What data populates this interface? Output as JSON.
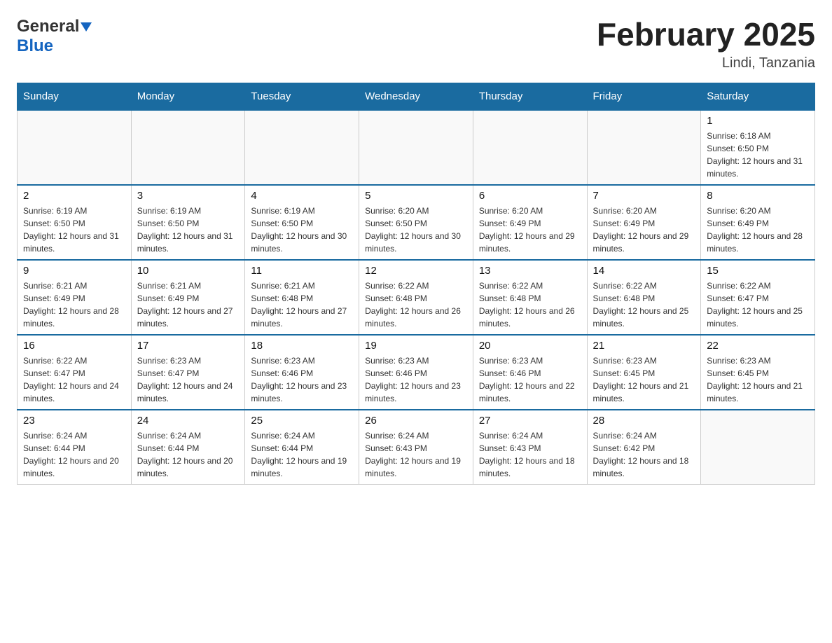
{
  "header": {
    "logo_general": "General",
    "logo_blue": "Blue",
    "month_title": "February 2025",
    "location": "Lindi, Tanzania"
  },
  "weekdays": [
    "Sunday",
    "Monday",
    "Tuesday",
    "Wednesday",
    "Thursday",
    "Friday",
    "Saturday"
  ],
  "weeks": [
    [
      {
        "day": "",
        "info": ""
      },
      {
        "day": "",
        "info": ""
      },
      {
        "day": "",
        "info": ""
      },
      {
        "day": "",
        "info": ""
      },
      {
        "day": "",
        "info": ""
      },
      {
        "day": "",
        "info": ""
      },
      {
        "day": "1",
        "info": "Sunrise: 6:18 AM\nSunset: 6:50 PM\nDaylight: 12 hours and 31 minutes."
      }
    ],
    [
      {
        "day": "2",
        "info": "Sunrise: 6:19 AM\nSunset: 6:50 PM\nDaylight: 12 hours and 31 minutes."
      },
      {
        "day": "3",
        "info": "Sunrise: 6:19 AM\nSunset: 6:50 PM\nDaylight: 12 hours and 31 minutes."
      },
      {
        "day": "4",
        "info": "Sunrise: 6:19 AM\nSunset: 6:50 PM\nDaylight: 12 hours and 30 minutes."
      },
      {
        "day": "5",
        "info": "Sunrise: 6:20 AM\nSunset: 6:50 PM\nDaylight: 12 hours and 30 minutes."
      },
      {
        "day": "6",
        "info": "Sunrise: 6:20 AM\nSunset: 6:49 PM\nDaylight: 12 hours and 29 minutes."
      },
      {
        "day": "7",
        "info": "Sunrise: 6:20 AM\nSunset: 6:49 PM\nDaylight: 12 hours and 29 minutes."
      },
      {
        "day": "8",
        "info": "Sunrise: 6:20 AM\nSunset: 6:49 PM\nDaylight: 12 hours and 28 minutes."
      }
    ],
    [
      {
        "day": "9",
        "info": "Sunrise: 6:21 AM\nSunset: 6:49 PM\nDaylight: 12 hours and 28 minutes."
      },
      {
        "day": "10",
        "info": "Sunrise: 6:21 AM\nSunset: 6:49 PM\nDaylight: 12 hours and 27 minutes."
      },
      {
        "day": "11",
        "info": "Sunrise: 6:21 AM\nSunset: 6:48 PM\nDaylight: 12 hours and 27 minutes."
      },
      {
        "day": "12",
        "info": "Sunrise: 6:22 AM\nSunset: 6:48 PM\nDaylight: 12 hours and 26 minutes."
      },
      {
        "day": "13",
        "info": "Sunrise: 6:22 AM\nSunset: 6:48 PM\nDaylight: 12 hours and 26 minutes."
      },
      {
        "day": "14",
        "info": "Sunrise: 6:22 AM\nSunset: 6:48 PM\nDaylight: 12 hours and 25 minutes."
      },
      {
        "day": "15",
        "info": "Sunrise: 6:22 AM\nSunset: 6:47 PM\nDaylight: 12 hours and 25 minutes."
      }
    ],
    [
      {
        "day": "16",
        "info": "Sunrise: 6:22 AM\nSunset: 6:47 PM\nDaylight: 12 hours and 24 minutes."
      },
      {
        "day": "17",
        "info": "Sunrise: 6:23 AM\nSunset: 6:47 PM\nDaylight: 12 hours and 24 minutes."
      },
      {
        "day": "18",
        "info": "Sunrise: 6:23 AM\nSunset: 6:46 PM\nDaylight: 12 hours and 23 minutes."
      },
      {
        "day": "19",
        "info": "Sunrise: 6:23 AM\nSunset: 6:46 PM\nDaylight: 12 hours and 23 minutes."
      },
      {
        "day": "20",
        "info": "Sunrise: 6:23 AM\nSunset: 6:46 PM\nDaylight: 12 hours and 22 minutes."
      },
      {
        "day": "21",
        "info": "Sunrise: 6:23 AM\nSunset: 6:45 PM\nDaylight: 12 hours and 21 minutes."
      },
      {
        "day": "22",
        "info": "Sunrise: 6:23 AM\nSunset: 6:45 PM\nDaylight: 12 hours and 21 minutes."
      }
    ],
    [
      {
        "day": "23",
        "info": "Sunrise: 6:24 AM\nSunset: 6:44 PM\nDaylight: 12 hours and 20 minutes."
      },
      {
        "day": "24",
        "info": "Sunrise: 6:24 AM\nSunset: 6:44 PM\nDaylight: 12 hours and 20 minutes."
      },
      {
        "day": "25",
        "info": "Sunrise: 6:24 AM\nSunset: 6:44 PM\nDaylight: 12 hours and 19 minutes."
      },
      {
        "day": "26",
        "info": "Sunrise: 6:24 AM\nSunset: 6:43 PM\nDaylight: 12 hours and 19 minutes."
      },
      {
        "day": "27",
        "info": "Sunrise: 6:24 AM\nSunset: 6:43 PM\nDaylight: 12 hours and 18 minutes."
      },
      {
        "day": "28",
        "info": "Sunrise: 6:24 AM\nSunset: 6:42 PM\nDaylight: 12 hours and 18 minutes."
      },
      {
        "day": "",
        "info": ""
      }
    ]
  ]
}
